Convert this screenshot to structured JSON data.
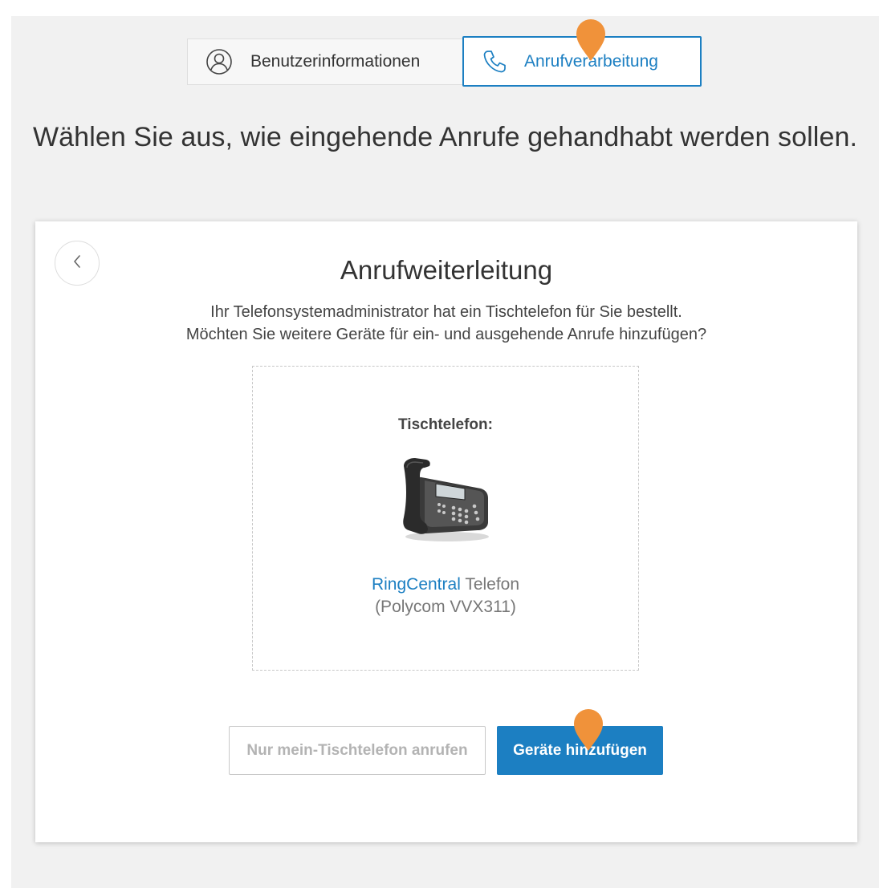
{
  "tabs": [
    {
      "label": "Benutzerinformationen",
      "icon": "user-circle-icon",
      "selected": false
    },
    {
      "label": "Anrufverarbeitung",
      "icon": "phone-icon",
      "selected": true
    }
  ],
  "headline": "Wählen Sie aus, wie eingehende Anrufe gehandhabt werden sollen.",
  "card": {
    "back_icon": "chevron-left-icon",
    "title": "Anrufweiterleitung",
    "description_line1": "Ihr Telefonsystemadministrator hat ein Tischtelefon für Sie bestellt.",
    "description_line2": "Möchten Sie weitere Geräte für ein- und ausgehende Anrufe hinzufügen?",
    "device": {
      "label": "Tischtelefon:",
      "brand": "RingCentral",
      "type": " Telefon",
      "model": "(Polycom VVX311)"
    },
    "secondary_button": "Nur mein-Tischtelefon anrufen",
    "primary_button": "Geräte hinzufügen"
  },
  "colors": {
    "accent": "#1c7fc2",
    "marker": "#f0923a",
    "background": "#f1f1f1"
  }
}
